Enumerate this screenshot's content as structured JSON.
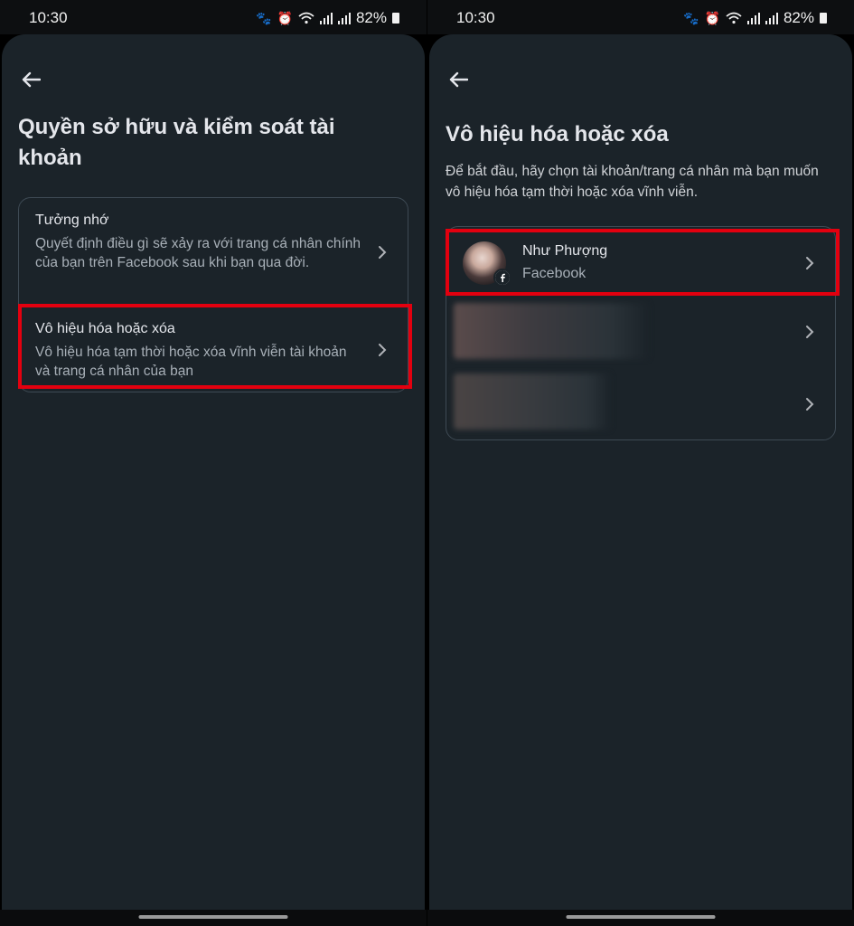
{
  "left": {
    "status": {
      "time": "10:30",
      "battery_pct": "82%"
    },
    "title": "Quyền sở hữu và kiểm soát tài khoản",
    "items": [
      {
        "title": "Tưởng nhớ",
        "desc": "Quyết định điều gì sẽ xảy ra với trang cá nhân chính của bạn trên Facebook sau khi bạn qua đời."
      },
      {
        "title": "Vô hiệu hóa hoặc xóa",
        "desc": "Vô hiệu hóa tạm thời hoặc xóa vĩnh viễn tài khoản và trang cá nhân của bạn"
      }
    ]
  },
  "right": {
    "status": {
      "time": "10:30",
      "battery_pct": "82%"
    },
    "title": "Vô hiệu hóa hoặc xóa",
    "description": "Để bắt đầu, hãy chọn tài khoản/trang cá nhân mà bạn muốn vô hiệu hóa tạm thời hoặc xóa vĩnh viễn.",
    "accounts": [
      {
        "name": "Như Phượng",
        "type": "Facebook"
      }
    ]
  },
  "colors": {
    "panel_bg": "#1b2329",
    "highlight": "#e3000f",
    "card_border": "#3e4a54"
  },
  "icons": [
    "back-arrow-icon",
    "chevron-right-icon",
    "facebook-icon",
    "paw-icon",
    "alarm-icon",
    "wifi-icon",
    "signal-icon",
    "battery-icon"
  ]
}
